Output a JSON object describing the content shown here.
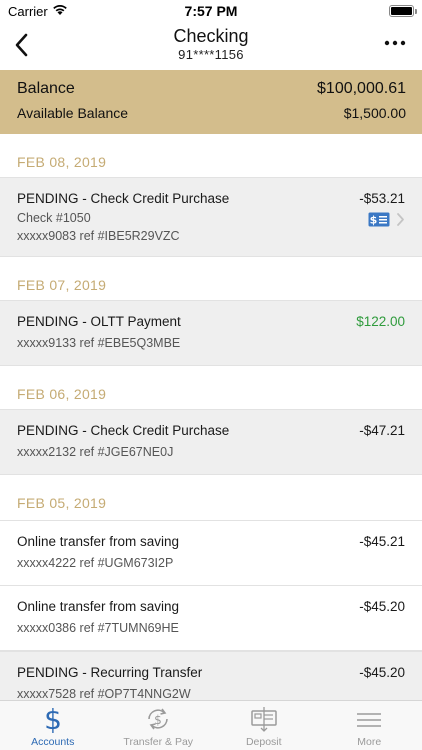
{
  "status_bar": {
    "carrier": "Carrier",
    "time": "7:57 PM"
  },
  "nav": {
    "title": "Checking",
    "subtitle": "91****1156",
    "back_icon": "chevron-left-icon",
    "more_icon": "ellipsis-icon"
  },
  "balance": {
    "label": "Balance",
    "value": "$100,000.61",
    "available_label": "Available Balance",
    "available_value": "$1,500.00",
    "panel_color": "#d3bd8c"
  },
  "groups": [
    {
      "date": "FEB 08, 2019",
      "transactions": [
        {
          "desc": "PENDING - Check Credit Purchase",
          "line2": "Check #1050",
          "ref": "xxxxx9083 ref #IBE5R29VZC",
          "amount": "-$53.21",
          "pending": true,
          "has_check_image": true
        }
      ]
    },
    {
      "date": "FEB 07, 2019",
      "transactions": [
        {
          "desc": "PENDING - OLTT Payment",
          "ref": "xxxxx9133 ref #EBE5Q3MBE",
          "amount": "$122.00",
          "pending": true,
          "credit": true
        }
      ]
    },
    {
      "date": "FEB 06, 2019",
      "transactions": [
        {
          "desc": "PENDING - Check Credit Purchase",
          "ref": "xxxxx2132 ref #JGE67NE0J",
          "amount": "-$47.21",
          "pending": true
        }
      ]
    },
    {
      "date": "FEB 05, 2019",
      "transactions": [
        {
          "desc": "Online transfer from saving",
          "ref": "xxxxx4222 ref #UGM673I2P",
          "amount": "-$45.21",
          "pending": false
        },
        {
          "desc": "Online transfer from saving",
          "ref": "xxxxx0386 ref #7TUMN69HE",
          "amount": "-$45.20",
          "pending": false
        },
        {
          "desc": "PENDING - Recurring Transfer",
          "ref": "xxxxx7528 ref #OP7T4NNG2W",
          "amount": "-$45.20",
          "pending": true
        }
      ]
    }
  ],
  "tabs": [
    {
      "label": "Accounts",
      "icon": "dollar-icon",
      "active": true
    },
    {
      "label": "Transfer & Pay",
      "icon": "transfer-dollar-icon",
      "active": false
    },
    {
      "label": "Deposit",
      "icon": "check-deposit-icon",
      "active": false
    },
    {
      "label": "More",
      "icon": "hamburger-menu-icon",
      "active": false
    }
  ],
  "colors": {
    "accent": "#2d6ab4",
    "date_header": "#c5ab74",
    "credit": "#2f9b3c",
    "pending_row": "#efefef"
  }
}
